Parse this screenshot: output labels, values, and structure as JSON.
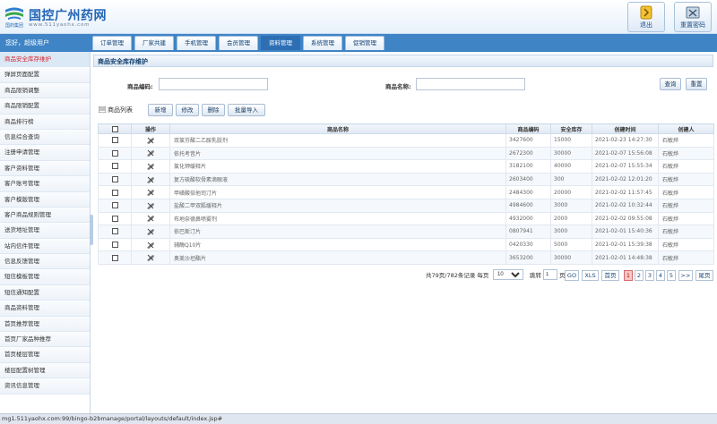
{
  "header": {
    "logo_group": "国药集团",
    "title": "国控广州药网",
    "url": "www.511yaohx.com",
    "buttons": [
      {
        "label": "退出",
        "icon": "exit-icon"
      },
      {
        "label": "重置密码",
        "icon": "reset-password-icon"
      }
    ]
  },
  "nav": {
    "welcome": "您好，超级用户",
    "tabs": [
      {
        "label": "订单管理"
      },
      {
        "label": "厂家共建"
      },
      {
        "label": "手机管理"
      },
      {
        "label": "会员管理"
      },
      {
        "label": "资料管理",
        "active": true
      },
      {
        "label": "系统管理"
      },
      {
        "label": "促销管理"
      }
    ]
  },
  "sidebar": {
    "items": [
      {
        "label": "商品安全库存维护",
        "active": true
      },
      {
        "label": "弹屏页面配置"
      },
      {
        "label": "商品限销调整"
      },
      {
        "label": "商品限销配置"
      },
      {
        "label": "商品排行榜"
      },
      {
        "label": "信息综合查询"
      },
      {
        "label": "注册申请管理"
      },
      {
        "label": "客户资料管理"
      },
      {
        "label": "客户账号管理"
      },
      {
        "label": "客户模版管理"
      },
      {
        "label": "客户商品规则管理"
      },
      {
        "label": "送货地址管理"
      },
      {
        "label": "站内信件管理"
      },
      {
        "label": "信息反馈管理"
      },
      {
        "label": "短信模板管理"
      },
      {
        "label": "短信通知配置"
      },
      {
        "label": "商品资料管理"
      },
      {
        "label": "首页推荐管理"
      },
      {
        "label": "首页厂家品种推荐"
      },
      {
        "label": "首页楼层管理"
      },
      {
        "label": "楼层配置树管理"
      },
      {
        "label": "资讯信息管理"
      }
    ]
  },
  "main": {
    "panel_title": "商品安全库存维护",
    "search": {
      "code_label": "商品编码:",
      "code_value": "",
      "name_label": "商品名称:",
      "name_value": "",
      "query_label": "查询",
      "reset_label": "重置"
    },
    "list": {
      "title": "商品列表",
      "toolbar": [
        "新增",
        "修改",
        "删除",
        "批量导入"
      ]
    },
    "table": {
      "headers": [
        "",
        "操作",
        "商品名称",
        "商品编码",
        "安全库存",
        "创建时间",
        "创建人"
      ],
      "rows": [
        {
          "name": "双氯芬酸二乙胺乳胶剂",
          "code": "3427600",
          "stock": "15000",
          "time": "2021-02-23 14:27:30",
          "creator": "石敏烨"
        },
        {
          "name": "依托考昔片",
          "code": "2672300",
          "stock": "30000",
          "time": "2021-02-07 15:56:08",
          "creator": "石敏烨"
        },
        {
          "name": "氯化钾缓释片",
          "code": "3182100",
          "stock": "40000",
          "time": "2021-02-07 15:55:34",
          "creator": "石敏烨"
        },
        {
          "name": "复方硫酸软骨素滴眼液",
          "code": "2603400",
          "stock": "300",
          "time": "2021-02-02 12:01:20",
          "creator": "石敏烨"
        },
        {
          "name": "甲磺酸倍他司汀片",
          "code": "2484300",
          "stock": "20000",
          "time": "2021-02-02 11:57:45",
          "creator": "石敏烨"
        },
        {
          "name": "盐酸二甲双胍缓释片",
          "code": "4984600",
          "stock": "3000",
          "time": "2021-02-02 10:32:44",
          "creator": "石敏烨"
        },
        {
          "name": "布地奈德鼻喷雾剂",
          "code": "4932000",
          "stock": "2000",
          "time": "2021-02-02 09:55:08",
          "creator": "石敏烨"
        },
        {
          "name": "依巴斯汀片",
          "code": "0807941",
          "stock": "3000",
          "time": "2021-02-01 15:40:36",
          "creator": "石敏烨"
        },
        {
          "name": "辅酶Q10片",
          "code": "0420330",
          "stock": "5000",
          "time": "2021-02-01 15:39:38",
          "creator": "石敏烨"
        },
        {
          "name": "奥美沙坦酯片",
          "code": "3653200",
          "stock": "30000",
          "time": "2021-02-01 14:48:38",
          "creator": "石敏烨"
        }
      ]
    },
    "pager": {
      "summary": "共79页/782条记录 每页",
      "page_size": "10",
      "jump_label": "跳转",
      "jump_value": "1",
      "page_unit": "页",
      "go": "GO",
      "xls": "XLS",
      "first": "首页",
      "pages": [
        "1",
        "2",
        "3",
        "4",
        "5"
      ],
      "current": "1",
      "next": ">>",
      "last": "尾页"
    }
  },
  "statusbar": {
    "url": "mg1.511yaohx.com:99/bingo-b2bmanage/portal/layouts/default/index.jsp#"
  },
  "colors": {
    "nav_blue": "#3f84c5",
    "active_red": "#d7262b",
    "brand_blue": "#2365b6"
  }
}
